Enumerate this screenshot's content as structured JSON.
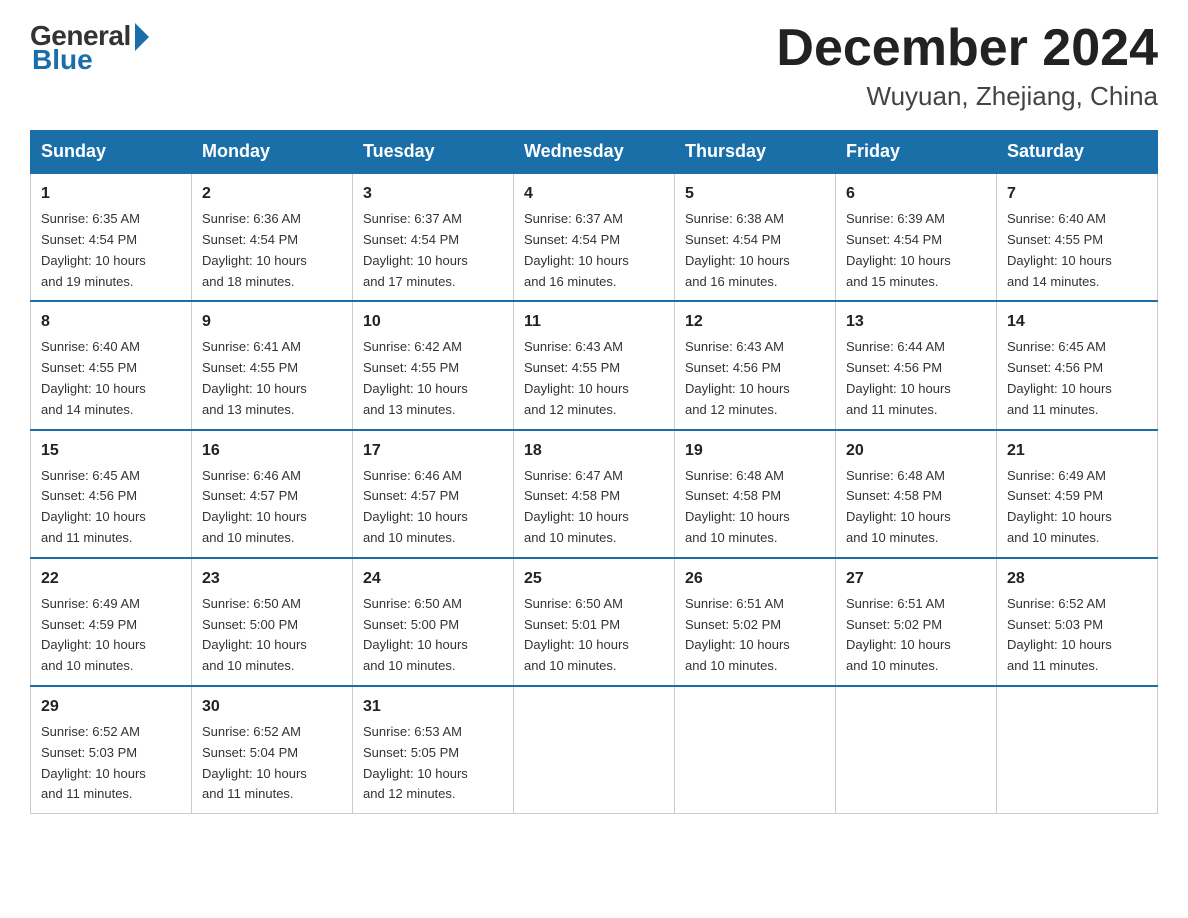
{
  "header": {
    "logo_general": "General",
    "logo_blue": "Blue",
    "month_title": "December 2024",
    "location": "Wuyuan, Zhejiang, China"
  },
  "days_of_week": [
    "Sunday",
    "Monday",
    "Tuesday",
    "Wednesday",
    "Thursday",
    "Friday",
    "Saturday"
  ],
  "weeks": [
    [
      {
        "day": "1",
        "sunrise": "6:35 AM",
        "sunset": "4:54 PM",
        "daylight": "10 hours and 19 minutes."
      },
      {
        "day": "2",
        "sunrise": "6:36 AM",
        "sunset": "4:54 PM",
        "daylight": "10 hours and 18 minutes."
      },
      {
        "day": "3",
        "sunrise": "6:37 AM",
        "sunset": "4:54 PM",
        "daylight": "10 hours and 17 minutes."
      },
      {
        "day": "4",
        "sunrise": "6:37 AM",
        "sunset": "4:54 PM",
        "daylight": "10 hours and 16 minutes."
      },
      {
        "day": "5",
        "sunrise": "6:38 AM",
        "sunset": "4:54 PM",
        "daylight": "10 hours and 16 minutes."
      },
      {
        "day": "6",
        "sunrise": "6:39 AM",
        "sunset": "4:54 PM",
        "daylight": "10 hours and 15 minutes."
      },
      {
        "day": "7",
        "sunrise": "6:40 AM",
        "sunset": "4:55 PM",
        "daylight": "10 hours and 14 minutes."
      }
    ],
    [
      {
        "day": "8",
        "sunrise": "6:40 AM",
        "sunset": "4:55 PM",
        "daylight": "10 hours and 14 minutes."
      },
      {
        "day": "9",
        "sunrise": "6:41 AM",
        "sunset": "4:55 PM",
        "daylight": "10 hours and 13 minutes."
      },
      {
        "day": "10",
        "sunrise": "6:42 AM",
        "sunset": "4:55 PM",
        "daylight": "10 hours and 13 minutes."
      },
      {
        "day": "11",
        "sunrise": "6:43 AM",
        "sunset": "4:55 PM",
        "daylight": "10 hours and 12 minutes."
      },
      {
        "day": "12",
        "sunrise": "6:43 AM",
        "sunset": "4:56 PM",
        "daylight": "10 hours and 12 minutes."
      },
      {
        "day": "13",
        "sunrise": "6:44 AM",
        "sunset": "4:56 PM",
        "daylight": "10 hours and 11 minutes."
      },
      {
        "day": "14",
        "sunrise": "6:45 AM",
        "sunset": "4:56 PM",
        "daylight": "10 hours and 11 minutes."
      }
    ],
    [
      {
        "day": "15",
        "sunrise": "6:45 AM",
        "sunset": "4:56 PM",
        "daylight": "10 hours and 11 minutes."
      },
      {
        "day": "16",
        "sunrise": "6:46 AM",
        "sunset": "4:57 PM",
        "daylight": "10 hours and 10 minutes."
      },
      {
        "day": "17",
        "sunrise": "6:46 AM",
        "sunset": "4:57 PM",
        "daylight": "10 hours and 10 minutes."
      },
      {
        "day": "18",
        "sunrise": "6:47 AM",
        "sunset": "4:58 PM",
        "daylight": "10 hours and 10 minutes."
      },
      {
        "day": "19",
        "sunrise": "6:48 AM",
        "sunset": "4:58 PM",
        "daylight": "10 hours and 10 minutes."
      },
      {
        "day": "20",
        "sunrise": "6:48 AM",
        "sunset": "4:58 PM",
        "daylight": "10 hours and 10 minutes."
      },
      {
        "day": "21",
        "sunrise": "6:49 AM",
        "sunset": "4:59 PM",
        "daylight": "10 hours and 10 minutes."
      }
    ],
    [
      {
        "day": "22",
        "sunrise": "6:49 AM",
        "sunset": "4:59 PM",
        "daylight": "10 hours and 10 minutes."
      },
      {
        "day": "23",
        "sunrise": "6:50 AM",
        "sunset": "5:00 PM",
        "daylight": "10 hours and 10 minutes."
      },
      {
        "day": "24",
        "sunrise": "6:50 AM",
        "sunset": "5:00 PM",
        "daylight": "10 hours and 10 minutes."
      },
      {
        "day": "25",
        "sunrise": "6:50 AM",
        "sunset": "5:01 PM",
        "daylight": "10 hours and 10 minutes."
      },
      {
        "day": "26",
        "sunrise": "6:51 AM",
        "sunset": "5:02 PM",
        "daylight": "10 hours and 10 minutes."
      },
      {
        "day": "27",
        "sunrise": "6:51 AM",
        "sunset": "5:02 PM",
        "daylight": "10 hours and 10 minutes."
      },
      {
        "day": "28",
        "sunrise": "6:52 AM",
        "sunset": "5:03 PM",
        "daylight": "10 hours and 11 minutes."
      }
    ],
    [
      {
        "day": "29",
        "sunrise": "6:52 AM",
        "sunset": "5:03 PM",
        "daylight": "10 hours and 11 minutes."
      },
      {
        "day": "30",
        "sunrise": "6:52 AM",
        "sunset": "5:04 PM",
        "daylight": "10 hours and 11 minutes."
      },
      {
        "day": "31",
        "sunrise": "6:53 AM",
        "sunset": "5:05 PM",
        "daylight": "10 hours and 12 minutes."
      },
      null,
      null,
      null,
      null
    ]
  ],
  "labels": {
    "sunrise": "Sunrise:",
    "sunset": "Sunset:",
    "daylight": "Daylight:"
  }
}
